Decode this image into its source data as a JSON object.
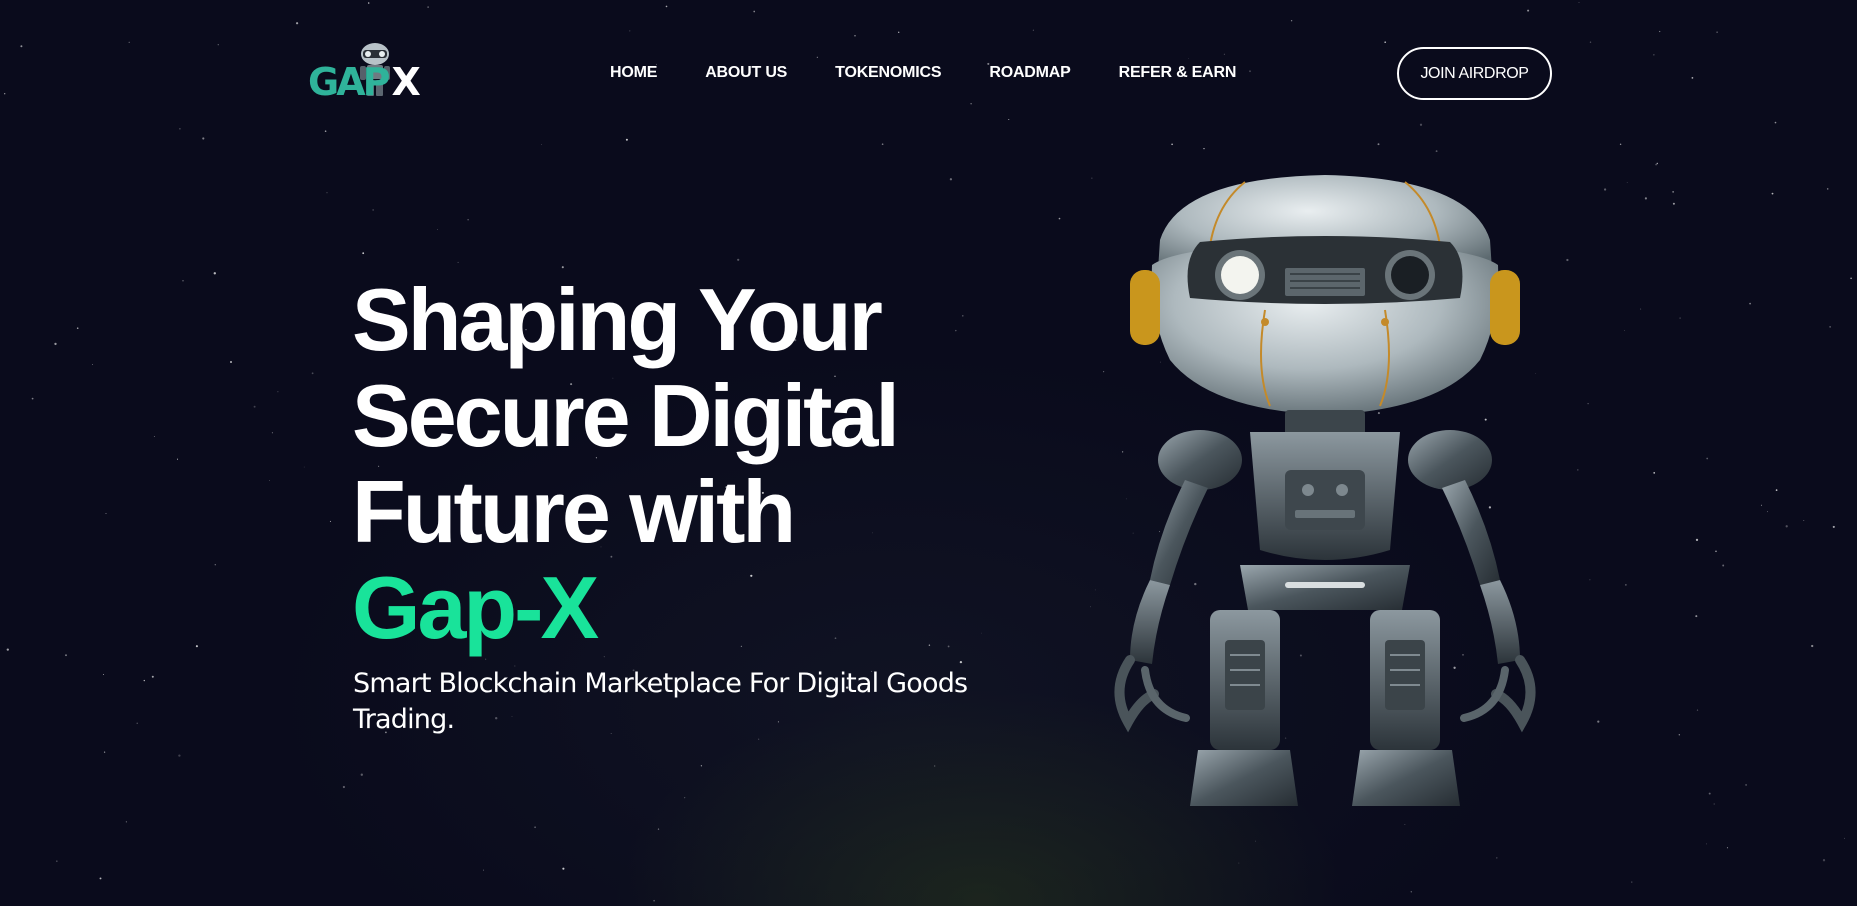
{
  "brand": {
    "logo_part1": "GAP",
    "logo_part2": "X",
    "accent_color": "#19e39a",
    "logo_color": "#2fb39a"
  },
  "nav": {
    "items": [
      {
        "label": "HOME"
      },
      {
        "label": "ABOUT US"
      },
      {
        "label": "TOKENOMICS"
      },
      {
        "label": "ROADMAP"
      },
      {
        "label": "REFER & EARN"
      }
    ]
  },
  "cta": {
    "join_label": "JOIN AIRDROP"
  },
  "hero": {
    "title_lines": [
      "Shaping Your",
      "Secure Digital",
      "Future with"
    ],
    "title_accent": "Gap-X",
    "subtitle": "Smart Blockchain Marketplace For Digital Goods Trading."
  },
  "images": {
    "hero_robot": "robot-illustration",
    "logo_mascot": "robot-mascot-icon"
  }
}
